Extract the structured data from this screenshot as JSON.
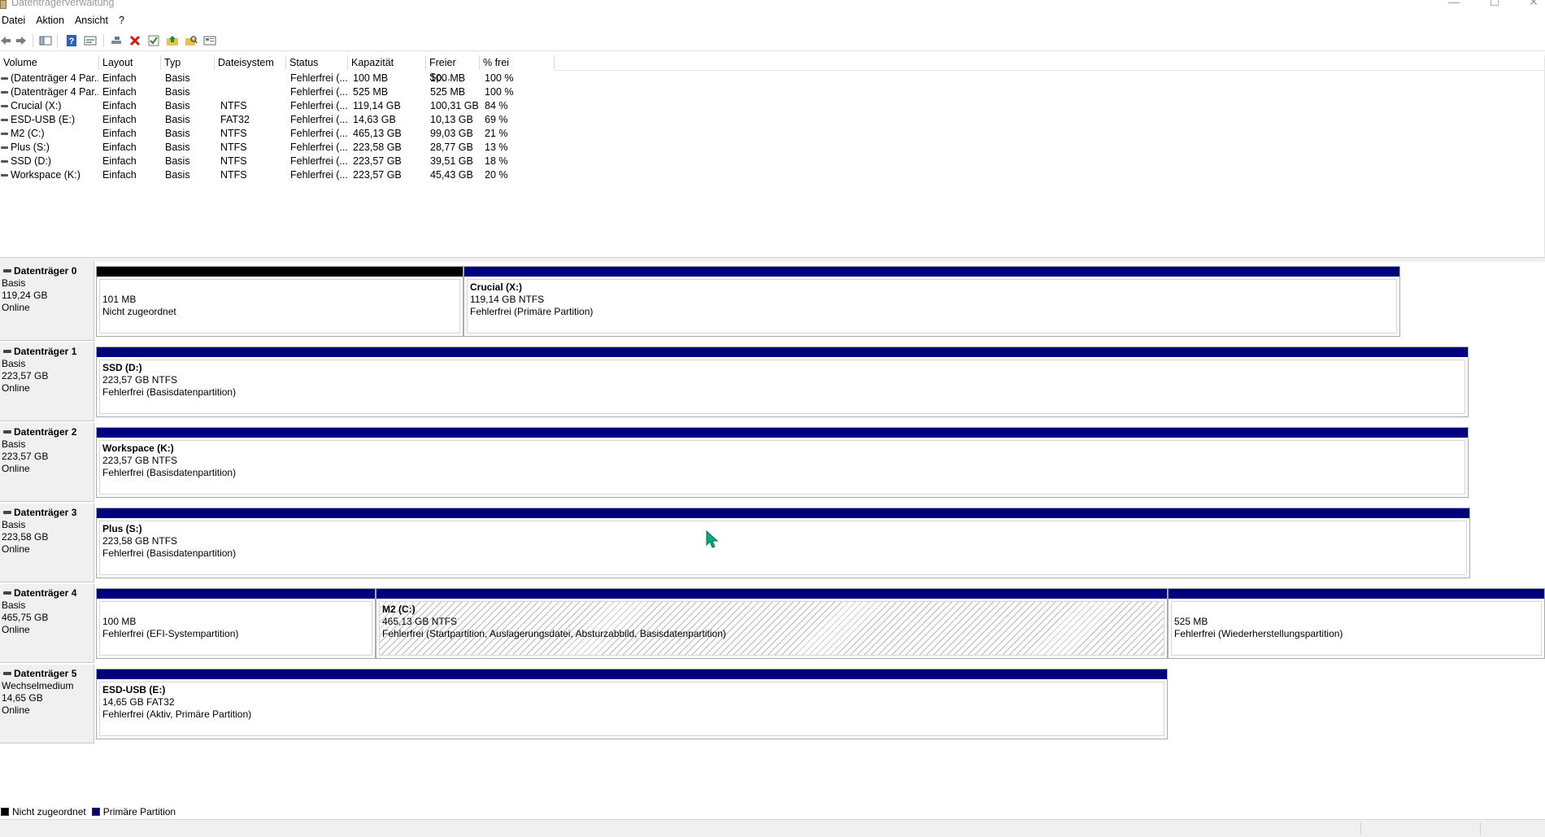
{
  "window": {
    "title": "Datenträgerverwaltung",
    "minimize": "—",
    "maximize": "☐",
    "close": "✕"
  },
  "menu": [
    "Datei",
    "Aktion",
    "Ansicht",
    "?"
  ],
  "toolbar": {
    "icons": [
      "back-icon",
      "forward-icon",
      "console-tree-icon",
      "help-icon",
      "properties-view-icon",
      "connect-icon",
      "delete-icon",
      "check-icon",
      "folder-up-icon",
      "folder-search-icon",
      "settings-icon"
    ]
  },
  "volume_table": {
    "headers": [
      "Volume",
      "Layout",
      "Typ",
      "Dateisystem",
      "Status",
      "Kapazität",
      "Freier Sp...",
      "% frei"
    ],
    "rows": [
      {
        "volume": "(Datenträger 4 Par...",
        "layout": "Einfach",
        "typ": "Basis",
        "fs": "",
        "status": "Fehlerfrei (...",
        "kap": "100 MB",
        "frei": "100 MB",
        "pct": "100 %"
      },
      {
        "volume": "(Datenträger 4 Par...",
        "layout": "Einfach",
        "typ": "Basis",
        "fs": "",
        "status": "Fehlerfrei (...",
        "kap": "525 MB",
        "frei": "525 MB",
        "pct": "100 %"
      },
      {
        "volume": "Crucial (X:)",
        "layout": "Einfach",
        "typ": "Basis",
        "fs": "NTFS",
        "status": "Fehlerfrei (...",
        "kap": "119,14 GB",
        "frei": "100,31 GB",
        "pct": "84 %"
      },
      {
        "volume": "ESD-USB (E:)",
        "layout": "Einfach",
        "typ": "Basis",
        "fs": "FAT32",
        "status": "Fehlerfrei (...",
        "kap": "14,63 GB",
        "frei": "10,13 GB",
        "pct": "69 %"
      },
      {
        "volume": "M2 (C:)",
        "layout": "Einfach",
        "typ": "Basis",
        "fs": "NTFS",
        "status": "Fehlerfrei (...",
        "kap": "465,13 GB",
        "frei": "99,03 GB",
        "pct": "21 %"
      },
      {
        "volume": "Plus (S:)",
        "layout": "Einfach",
        "typ": "Basis",
        "fs": "NTFS",
        "status": "Fehlerfrei (...",
        "kap": "223,58 GB",
        "frei": "28,77 GB",
        "pct": "13 %"
      },
      {
        "volume": "SSD (D:)",
        "layout": "Einfach",
        "typ": "Basis",
        "fs": "NTFS",
        "status": "Fehlerfrei (...",
        "kap": "223,57 GB",
        "frei": "39,51 GB",
        "pct": "18 %"
      },
      {
        "volume": "Workspace (K:)",
        "layout": "Einfach",
        "typ": "Basis",
        "fs": "NTFS",
        "status": "Fehlerfrei (...",
        "kap": "223,57 GB",
        "frei": "45,43 GB",
        "pct": "20 %"
      }
    ]
  },
  "disks": [
    {
      "name": "Datenträger 0",
      "type": "Basis",
      "size": "119,24 GB",
      "state": "Online",
      "parts": [
        {
          "name": "",
          "line2": "101 MB",
          "line3": "Nicht zugeordnet",
          "kind": "unallocated"
        },
        {
          "name": "Crucial  (X:)",
          "line2": "119,14 GB NTFS",
          "line3": "Fehlerfrei (Primäre Partition)",
          "kind": "primary"
        }
      ]
    },
    {
      "name": "Datenträger 1",
      "type": "Basis",
      "size": "223,57 GB",
      "state": "Online",
      "parts": [
        {
          "name": "SSD  (D:)",
          "line2": "223,57 GB NTFS",
          "line3": "Fehlerfrei (Basisdatenpartition)",
          "kind": "primary"
        }
      ]
    },
    {
      "name": "Datenträger 2",
      "type": "Basis",
      "size": "223,57 GB",
      "state": "Online",
      "parts": [
        {
          "name": "Workspace  (K:)",
          "line2": "223,57 GB NTFS",
          "line3": "Fehlerfrei (Basisdatenpartition)",
          "kind": "primary"
        }
      ]
    },
    {
      "name": "Datenträger 3",
      "type": "Basis",
      "size": "223,58 GB",
      "state": "Online",
      "parts": [
        {
          "name": "Plus  (S:)",
          "line2": "223,58 GB NTFS",
          "line3": "Fehlerfrei (Basisdatenpartition)",
          "kind": "primary"
        }
      ]
    },
    {
      "name": "Datenträger 4",
      "type": "Basis",
      "size": "465,75 GB",
      "state": "Online",
      "parts": [
        {
          "name": "",
          "line2": "100 MB",
          "line3": "Fehlerfrei (EFI-Systempartition)",
          "kind": "primary"
        },
        {
          "name": "M2  (C:)",
          "line2": "465,13 GB NTFS",
          "line3": "Fehlerfrei (Startpartition, Auslagerungsdatei, Absturzabbild, Basisdatenpartition)",
          "kind": "primary-selected"
        },
        {
          "name": "",
          "line2": "525 MB",
          "line3": "Fehlerfrei (Wiederherstellungspartition)",
          "kind": "primary"
        }
      ]
    },
    {
      "name": "Datenträger 5",
      "type": "Wechselmedium",
      "size": "14,65 GB",
      "state": "Online",
      "parts": [
        {
          "name": "ESD-USB  (E:)",
          "line2": "14,65 GB FAT32",
          "line3": "Fehlerfrei (Aktiv, Primäre Partition)",
          "kind": "primary"
        }
      ]
    }
  ],
  "legend": [
    {
      "label": "Nicht zugeordnet",
      "color": "#000000"
    },
    {
      "label": "Primäre Partition",
      "color": "#00007f"
    }
  ],
  "colors": {
    "primary": "#00007f",
    "unallocated": "#000000",
    "label_bg": "#f0f0f0"
  }
}
